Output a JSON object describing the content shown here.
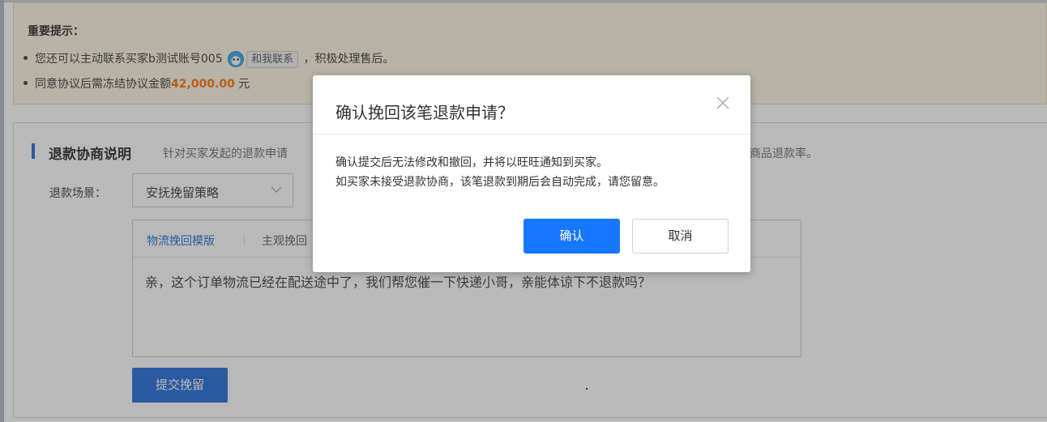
{
  "notice": {
    "title": "重要提示：",
    "item1_prefix": "您还可以主动联系买家b测试账号005",
    "wangwang_label": "和我联系",
    "item1_suffix": "，积极处理售后。",
    "item2_prefix": "同意协议后需冻结协议金额",
    "item2_amount": "42,000.00",
    "item2_suffix": "元"
  },
  "section": {
    "title": "退款协商说明",
    "desc_left": "针对买家发起的退款申请",
    "desc_right": "低商品退款率。",
    "scene_label": "退款场景：",
    "scene_value": "安抚挽留策略",
    "tabs": [
      "物流挽回模版",
      "主观挽回"
    ],
    "template_text": "亲，这个订单物流已经在配送途中了，我们帮您催一下快递小哥，亲能体谅下不退款吗？",
    "submit_label": "提交挽留"
  },
  "dialog": {
    "title": "确认挽回该笔退款申请？",
    "line1": "确认提交后无法修改和撤回，并将以旺旺通知到买家。",
    "line2": "如买家未接受退款协商，该笔退款到期后会自动完成，请您留意。",
    "ok_label": "确认",
    "cancel_label": "取消"
  },
  "colors": {
    "primary": "#1677ff",
    "section_blue": "#1a66d9",
    "amount_orange": "#ff6a00",
    "notice_bg": "#fdf6e3"
  },
  "icons": [
    "wangwang-icon",
    "chevron-down-icon",
    "close-icon"
  ]
}
